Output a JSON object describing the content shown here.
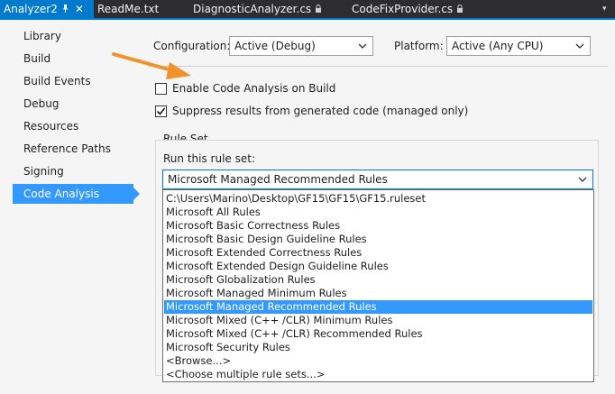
{
  "tabs": [
    {
      "label": "Analyzer2",
      "active": true,
      "close": "✕",
      "pin_icon": "pin-icon"
    },
    {
      "label": "ReadMe.txt"
    },
    {
      "label": "DiagnosticAnalyzer.cs",
      "lock": "🔒"
    },
    {
      "label": "CodeFixProvider.cs",
      "lock": "🔒"
    }
  ],
  "tab_overflow_icon": "▾",
  "sidebar": {
    "items": [
      {
        "label": "Library"
      },
      {
        "label": "Build"
      },
      {
        "label": "Build Events"
      },
      {
        "label": "Debug"
      },
      {
        "label": "Resources"
      },
      {
        "label": "Reference Paths"
      },
      {
        "label": "Signing"
      },
      {
        "label": "Code Analysis",
        "selected": true
      }
    ]
  },
  "config": {
    "configuration_label": "Configuration:",
    "configuration_value": "Active (Debug)",
    "platform_label": "Platform:",
    "platform_value": "Active (Any CPU)"
  },
  "options": {
    "enable_code_analysis": {
      "label": "Enable Code Analysis on Build",
      "checked": false
    },
    "suppress_generated": {
      "label": "Suppress results from generated code (managed only)",
      "checked": true
    }
  },
  "ruleset": {
    "group_label": "Rule Set",
    "run_label": "Run this rule set:",
    "selected": "Microsoft Managed Recommended Rules",
    "options": [
      "C:\\Users\\Marino\\Desktop\\GF15\\GF15\\GF15.ruleset",
      "Microsoft All Rules",
      "Microsoft Basic Correctness Rules",
      "Microsoft Basic Design Guideline Rules",
      "Microsoft Extended Correctness Rules",
      "Microsoft Extended Design Guideline Rules",
      "Microsoft Globalization Rules",
      "Microsoft Managed Minimum Rules",
      "Microsoft Managed Recommended Rules",
      "Microsoft Mixed (C++ /CLR) Minimum Rules",
      "Microsoft Mixed (C++ /CLR) Recommended Rules",
      "Microsoft Security Rules",
      "<Browse...>",
      "<Choose multiple rule sets...>"
    ],
    "highlighted_index": 8
  },
  "colors": {
    "accent": "#007acc",
    "selection": "#3399ff",
    "annotation_arrow": "#f0922a"
  }
}
